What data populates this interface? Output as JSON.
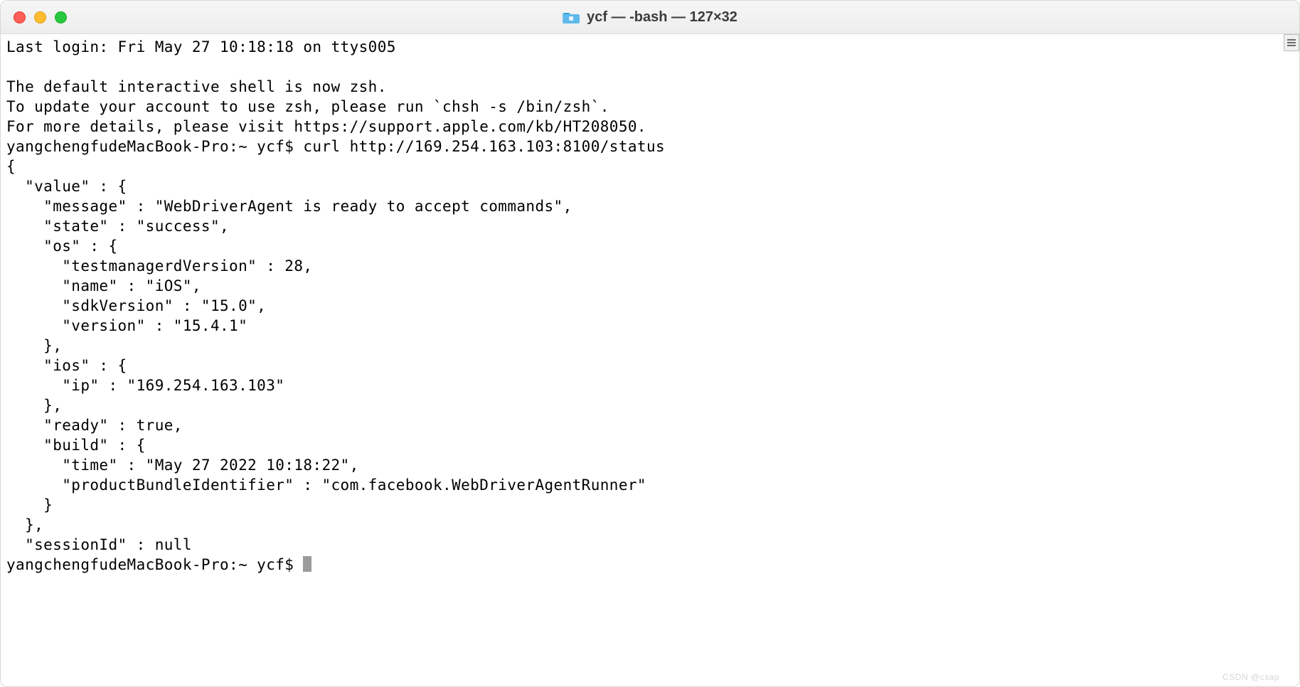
{
  "window": {
    "title": "ycf — -bash — 127×32"
  },
  "terminal": {
    "last_login": "Last login: Fri May 27 10:18:18 on ttys005",
    "blank": "",
    "zsh_notice_1": "The default interactive shell is now zsh.",
    "zsh_notice_2": "To update your account to use zsh, please run `chsh -s /bin/zsh`.",
    "zsh_notice_3": "For more details, please visit https://support.apple.com/kb/HT208050.",
    "prompt1_prefix": "[",
    "prompt1": "yangchengfudeMacBook-Pro:~ ycf$ curl http://169.254.163.103:8100/status",
    "prompt1_suffix": "]",
    "json_lines": [
      "{",
      "  \"value\" : {",
      "    \"message\" : \"WebDriverAgent is ready to accept commands\",",
      "    \"state\" : \"success\",",
      "    \"os\" : {",
      "      \"testmanagerdVersion\" : 28,",
      "      \"name\" : \"iOS\",",
      "      \"sdkVersion\" : \"15.0\",",
      "      \"version\" : \"15.4.1\"",
      "    },",
      "    \"ios\" : {",
      "      \"ip\" : \"169.254.163.103\"",
      "    },",
      "    \"ready\" : true,",
      "    \"build\" : {",
      "      \"time\" : \"May 27 2022 10:18:22\",",
      "      \"productBundleIdentifier\" : \"com.facebook.WebDriverAgentRunner\"",
      "    }",
      "  },",
      "  \"sessionId\" : null"
    ],
    "prompt2": "yangchengfudeMacBook-Pro:~ ycf$ "
  },
  "watermark": "CSDN @csap"
}
